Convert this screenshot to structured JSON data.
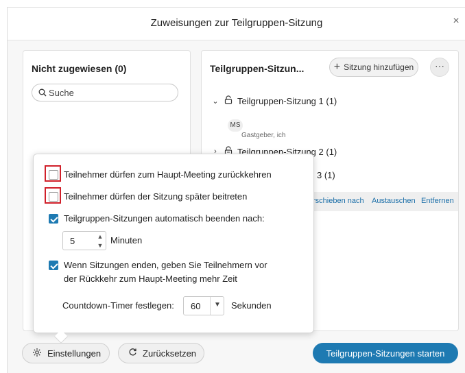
{
  "dialog": {
    "title": "Zuweisungen zur Teilgruppen-Sitzung",
    "close_label": "×"
  },
  "unassigned": {
    "heading": "Nicht zugewiesen (0)",
    "search_placeholder": "Suche"
  },
  "sessions": {
    "heading": "Teilgruppen-Sitzun...",
    "add_button": "Sitzung hinzufügen",
    "more_label": "···",
    "items": [
      {
        "label": "Teilgruppen-Sitzung 1 (1)",
        "expanded": true
      },
      {
        "label": "Teilgruppen-Sitzung 2 (1)",
        "expanded": false
      },
      {
        "label": "3 (1)",
        "expanded": false
      }
    ],
    "member": {
      "initials": "MS",
      "role": "Gastgeber, ich"
    },
    "actions": {
      "move": "rschieben nach",
      "swap": "Austauschen",
      "remove": "Entfernen"
    }
  },
  "settings_popover": {
    "options": [
      {
        "label": "Teilnehmer dürfen zum Haupt-Meeting zurückkehren",
        "checked": false,
        "highlighted": true
      },
      {
        "label": "Teilnehmer dürfen der Sitzung später beitreten",
        "checked": false,
        "highlighted": true
      },
      {
        "label": "Teilgruppen-Sitzungen automatisch beenden nach:",
        "checked": true
      },
      {
        "label": "Wenn Sitzungen enden, geben Sie Teilnehmern vor der Rückkehr zum Haupt-Meeting mehr Zeit",
        "checked": true
      }
    ],
    "auto_end": {
      "value": "5",
      "unit": "Minuten"
    },
    "countdown": {
      "label": "Countdown-Timer festlegen:",
      "value": "60",
      "unit": "Sekunden"
    }
  },
  "footer": {
    "settings_button": "Einstellungen",
    "reset_button": "Zurücksetzen",
    "start_button": "Teilgruppen-Sitzungen starten"
  },
  "colors": {
    "accent": "#1e7ab2",
    "highlight": "#d0202a",
    "link": "#1a6ea8"
  }
}
